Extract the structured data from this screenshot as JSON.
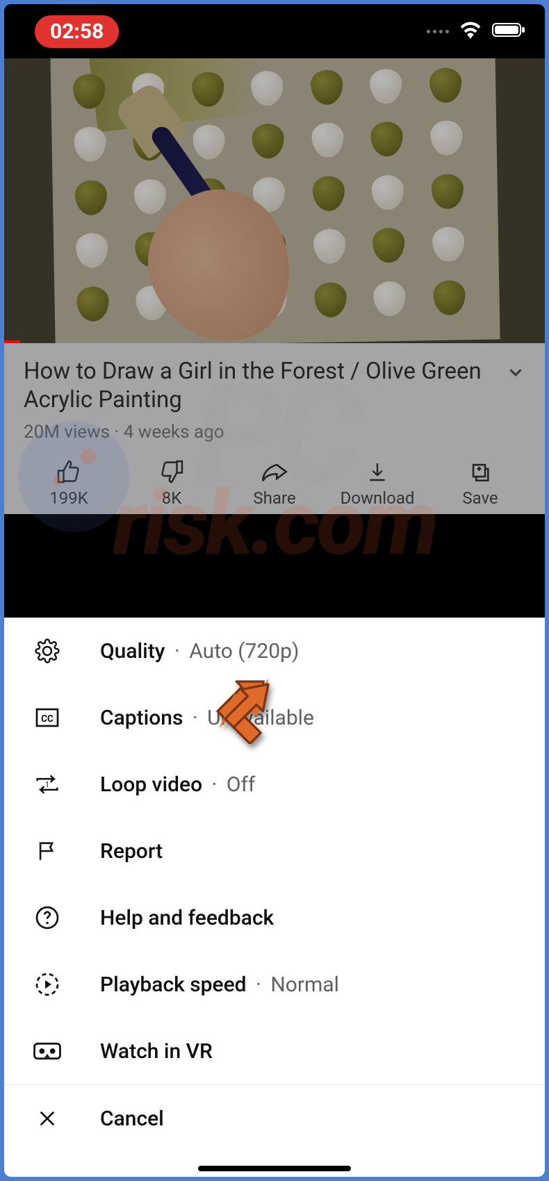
{
  "status": {
    "time": "02:58"
  },
  "video": {
    "title": "How to Draw a Girl in the Forest / Olive Green Acrylic Painting",
    "views": "20M views",
    "age": "4 weeks ago"
  },
  "actions": {
    "like": {
      "label": "199K"
    },
    "dislike": {
      "label": "8K"
    },
    "share": {
      "label": "Share"
    },
    "download": {
      "label": "Download"
    },
    "save": {
      "label": "Save"
    }
  },
  "menu": {
    "quality": {
      "label": "Quality",
      "value": "Auto (720p)"
    },
    "captions": {
      "label": "Captions",
      "value": "Unavailable"
    },
    "loop": {
      "label": "Loop video",
      "value": "Off"
    },
    "report": {
      "label": "Report"
    },
    "help": {
      "label": "Help and feedback"
    },
    "speed": {
      "label": "Playback speed",
      "value": "Normal"
    },
    "vr": {
      "label": "Watch in VR"
    },
    "cancel": {
      "label": "Cancel"
    }
  },
  "watermark": {
    "line1": "PC",
    "line2": "risk.com"
  }
}
